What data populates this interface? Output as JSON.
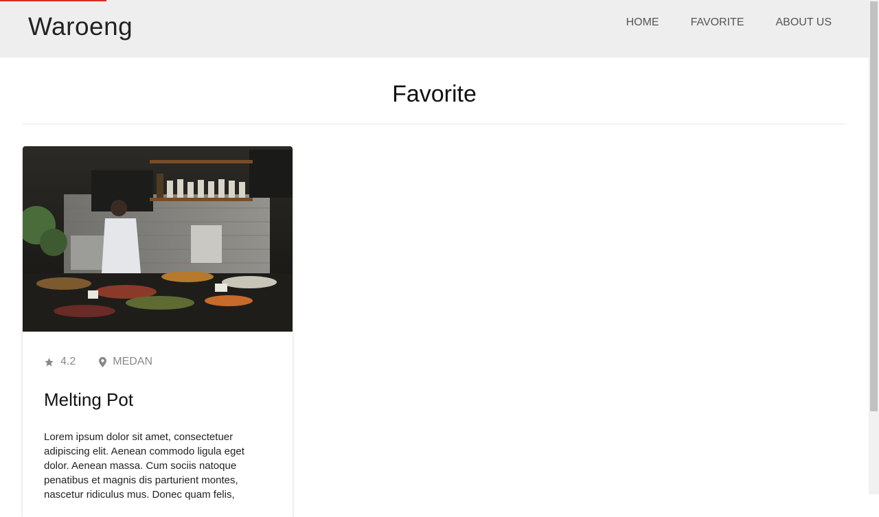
{
  "brand": "Waroeng",
  "nav": {
    "home": "HOME",
    "favorite": "FAVORITE",
    "about": "ABOUT US"
  },
  "page": {
    "title": "Favorite"
  },
  "card": {
    "rating": "4.2",
    "location": "MEDAN",
    "title": "Melting Pot",
    "description": "Lorem ipsum dolor sit amet, consectetuer adipiscing elit. Aenean commodo ligula eget dolor. Aenean massa. Cum sociis natoque penatibus et magnis dis parturient montes, nascetur ridiculus mus. Donec quam felis,",
    "icons": {
      "rating": "star-icon",
      "location": "map-pin-icon"
    }
  },
  "colors": {
    "accent": "#d62d20",
    "navbar": "#eeeeee",
    "muted_text": "#888888"
  }
}
